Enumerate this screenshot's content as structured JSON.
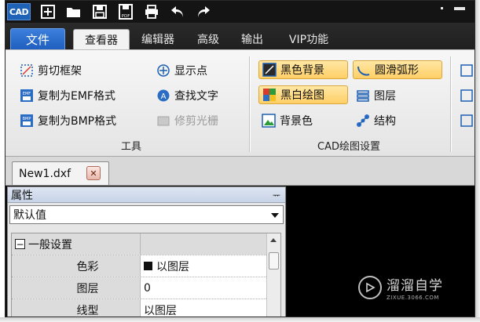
{
  "app": {
    "logo_text": "CAD"
  },
  "quick_access": {
    "icons": [
      "new-icon",
      "open-icon",
      "save-icon",
      "save-pdf-icon",
      "print-icon",
      "undo-icon",
      "redo-icon"
    ],
    "pdf_label": "PDF"
  },
  "ribbon_tabs": {
    "file": "文件",
    "items": [
      "查看器",
      "编辑器",
      "高级",
      "输出",
      "VIP功能"
    ],
    "active": "查看器"
  },
  "tools_group": {
    "label": "工具",
    "items": [
      {
        "label": "剪切框架",
        "icon": "crop-frame-icon",
        "state": "normal"
      },
      {
        "label": "复制为EMF格式",
        "icon": "copy-emf-icon",
        "state": "normal"
      },
      {
        "label": "复制为BMP格式",
        "icon": "copy-bmp-icon",
        "state": "normal"
      },
      {
        "label": "显示点",
        "icon": "show-points-icon",
        "state": "normal"
      },
      {
        "label": "查找文字",
        "icon": "find-text-icon",
        "state": "normal"
      },
      {
        "label": "修剪光栅",
        "icon": "trim-raster-icon",
        "state": "disabled"
      }
    ],
    "emf_badge": "EMF",
    "bmp_badge": "BMP"
  },
  "cad_settings_group": {
    "label": "CAD绘图设置",
    "items": [
      {
        "label": "黑色背景",
        "icon": "black-background-icon",
        "state": "checked"
      },
      {
        "label": "黑白绘图",
        "icon": "bw-drawing-icon",
        "state": "checked"
      },
      {
        "label": "背景色",
        "icon": "background-color-icon",
        "state": "normal"
      },
      {
        "label": "圆滑弧形",
        "icon": "smooth-arc-icon",
        "state": "checked"
      },
      {
        "label": "图层",
        "icon": "layers-icon",
        "state": "normal"
      },
      {
        "label": "结构",
        "icon": "structure-icon",
        "state": "normal"
      }
    ]
  },
  "document_tab": {
    "label": "New1.dxf",
    "close": "✕"
  },
  "properties_panel": {
    "title": "属性",
    "pin": "ᅲ",
    "dropdown_value": "默认值",
    "category": {
      "label": "一般设置",
      "expander": "−"
    },
    "rows": [
      {
        "name": "色彩",
        "value": "以图层",
        "has_swatch": true
      },
      {
        "name": "图层",
        "value": "0",
        "has_swatch": false
      },
      {
        "name": "线型",
        "value": "以图层",
        "has_swatch": false
      }
    ]
  },
  "watermark": {
    "title": "溜溜自学",
    "subtitle": "ZIXUE.3066.COM"
  },
  "colors": {
    "accent_blue": "#1e5fbf",
    "checked_fill": "#ffcf66",
    "canvas": "#000000"
  }
}
